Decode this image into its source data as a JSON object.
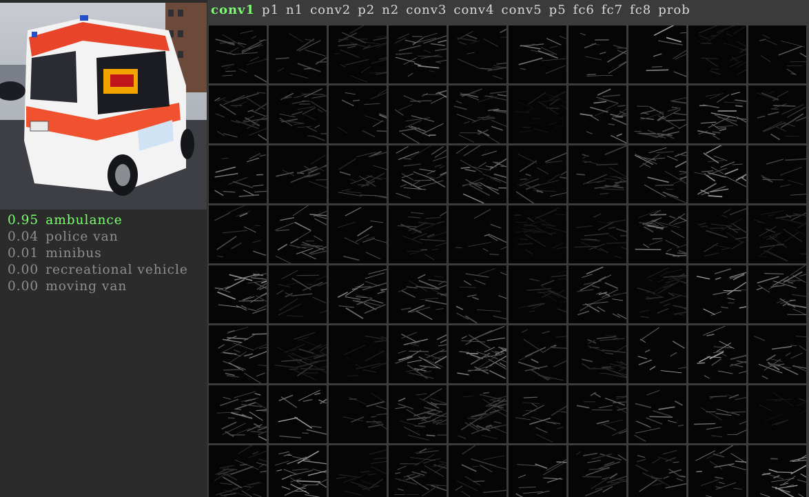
{
  "input_image": {
    "description_icon": "ambulance-photo"
  },
  "predictions": [
    {
      "score": "0.95",
      "label": "ambulance"
    },
    {
      "score": "0.04",
      "label": "police van"
    },
    {
      "score": "0.01",
      "label": "minibus"
    },
    {
      "score": "0.00",
      "label": "recreational vehicle"
    },
    {
      "score": "0.00",
      "label": "moving van"
    }
  ],
  "layers": [
    "conv1",
    "p1",
    "n1",
    "conv2",
    "p2",
    "n2",
    "conv3",
    "conv4",
    "conv5",
    "p5",
    "fc6",
    "fc7",
    "fc8",
    "prob"
  ],
  "active_layer": "conv1",
  "colors": {
    "background": "#2b2b2b",
    "active": "#7cff6f",
    "inactive_text": "#8f8f8f",
    "tab_text": "#d9d9d9"
  },
  "grid": {
    "columns": 10,
    "rows": 8
  }
}
